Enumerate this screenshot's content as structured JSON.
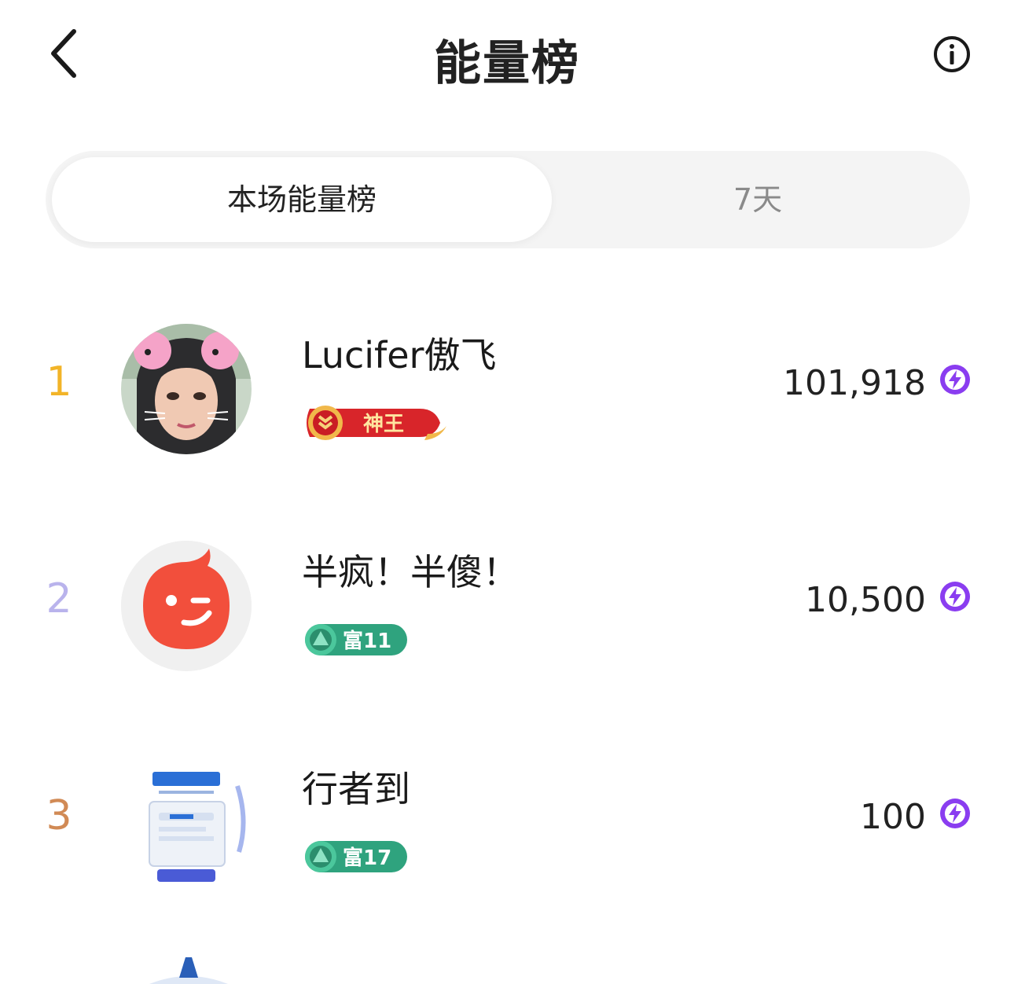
{
  "header": {
    "title": "能量榜",
    "back_icon": "chevron-left-icon",
    "info_icon": "info-circle-icon"
  },
  "tabs": [
    {
      "label": "本场能量榜",
      "active": true
    },
    {
      "label": "7天",
      "active": false
    }
  ],
  "leaderboard": [
    {
      "rank": "1",
      "name": "Lucifer傲飞",
      "badge": "神王",
      "score": "101,918",
      "rank_color": "#f2b428"
    },
    {
      "rank": "2",
      "name": "半疯！半傻！",
      "badge": "富11",
      "score": "10,500",
      "rank_color": "#b9b3ec"
    },
    {
      "rank": "3",
      "name": "行者到",
      "badge": "富17",
      "score": "100",
      "rank_color": "#d18a55"
    }
  ],
  "colors": {
    "energy_icon": "#8a3df0",
    "badge_red": "#d8252a",
    "badge_green": "#2fa37e"
  }
}
